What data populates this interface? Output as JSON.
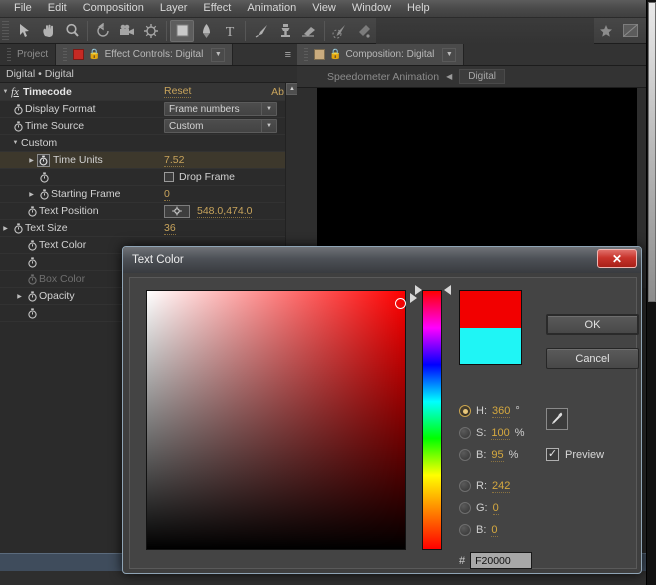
{
  "menu": {
    "items": [
      "File",
      "Edit",
      "Composition",
      "Layer",
      "Effect",
      "Animation",
      "View",
      "Window",
      "Help"
    ]
  },
  "toolbar": {
    "tools": [
      {
        "name": "selection-tool-icon",
        "glyph": "arrow"
      },
      {
        "name": "hand-tool-icon",
        "glyph": "hand"
      },
      {
        "name": "zoom-tool-icon",
        "glyph": "magnifier"
      },
      {
        "name": "rotation-tool-icon",
        "glyph": "rotate"
      },
      {
        "name": "camera-tool-icon",
        "glyph": "camera"
      },
      {
        "name": "pan-behind-tool-icon",
        "glyph": "anchor"
      },
      {
        "name": "shape-tool-icon",
        "glyph": "square"
      },
      {
        "name": "pen-tool-icon",
        "glyph": "pen"
      },
      {
        "name": "type-tool-icon",
        "glyph": "T"
      },
      {
        "name": "brush-tool-icon",
        "glyph": "brush"
      },
      {
        "name": "clone-stamp-tool-icon",
        "glyph": "stamp"
      },
      {
        "name": "eraser-tool-icon",
        "glyph": "eraser"
      },
      {
        "name": "roto-brush-tool-icon",
        "glyph": "rotobrush"
      },
      {
        "name": "puppet-pin-tool-icon",
        "glyph": "puppet"
      },
      {
        "name": "favorites-star-icon",
        "glyph": "star"
      },
      {
        "name": "workspace-icon",
        "glyph": "grid"
      }
    ]
  },
  "effect_panel": {
    "tabs": [
      {
        "label": "Project",
        "selected": false
      },
      {
        "label": "Effect Controls: Digital",
        "selected": true
      }
    ],
    "breadcrumb": "Digital • Digital",
    "effect_title": "Timecode",
    "reset_label": "Reset",
    "about_label": "Ab",
    "properties": [
      {
        "name": "Display Format",
        "value": "Frame numbers",
        "type": "combo"
      },
      {
        "name": "Time Source",
        "value": "Custom",
        "type": "combo"
      },
      {
        "name": "Custom",
        "value": "",
        "type": "group"
      },
      {
        "name": "Time Units",
        "value": "7.52",
        "type": "number"
      },
      {
        "name": "",
        "value": "Drop Frame",
        "type": "checkbox"
      },
      {
        "name": "Starting Frame",
        "value": "0",
        "type": "number"
      },
      {
        "name": "Text Position",
        "value": "548.0,474.0",
        "type": "point"
      },
      {
        "name": "Text Size",
        "value": "36",
        "type": "number"
      },
      {
        "name": "Text Color",
        "value": "",
        "type": "color"
      },
      {
        "name": "Box Color",
        "value": "",
        "type": "color",
        "disabled": true
      },
      {
        "name": "Opacity",
        "value": "",
        "type": "number"
      }
    ]
  },
  "comp_panel": {
    "tab_label": "Composition: Digital",
    "breadcrumb_project": "Speedometer Animation",
    "breadcrumb_comp": "Digital"
  },
  "dialog": {
    "title": "Text Color",
    "close_label": "✕",
    "ok_label": "OK",
    "cancel_label": "Cancel",
    "eyedropper_name": "eyedropper-icon",
    "preview_label": "Preview",
    "preview_checked": true,
    "preview_check_glyph": "✓",
    "hex_hash": "#",
    "hex_value": "F20000",
    "new_color": "#F20000",
    "old_color": "#1FF5F5",
    "selected_channel": "H",
    "channels": [
      {
        "id": "H",
        "label": "H:",
        "value": "360",
        "unit": "°",
        "selected": true
      },
      {
        "id": "S",
        "label": "S:",
        "value": "100",
        "unit": "%",
        "selected": false
      },
      {
        "id": "B",
        "label": "B:",
        "value": "95",
        "unit": "%",
        "selected": false
      },
      {
        "id": "R",
        "label": "R:",
        "value": "242",
        "unit": "",
        "selected": false
      },
      {
        "id": "G",
        "label": "G:",
        "value": "0",
        "unit": "",
        "selected": false
      },
      {
        "id": "Bv",
        "label": "B:",
        "value": "0",
        "unit": "",
        "selected": false
      }
    ]
  }
}
